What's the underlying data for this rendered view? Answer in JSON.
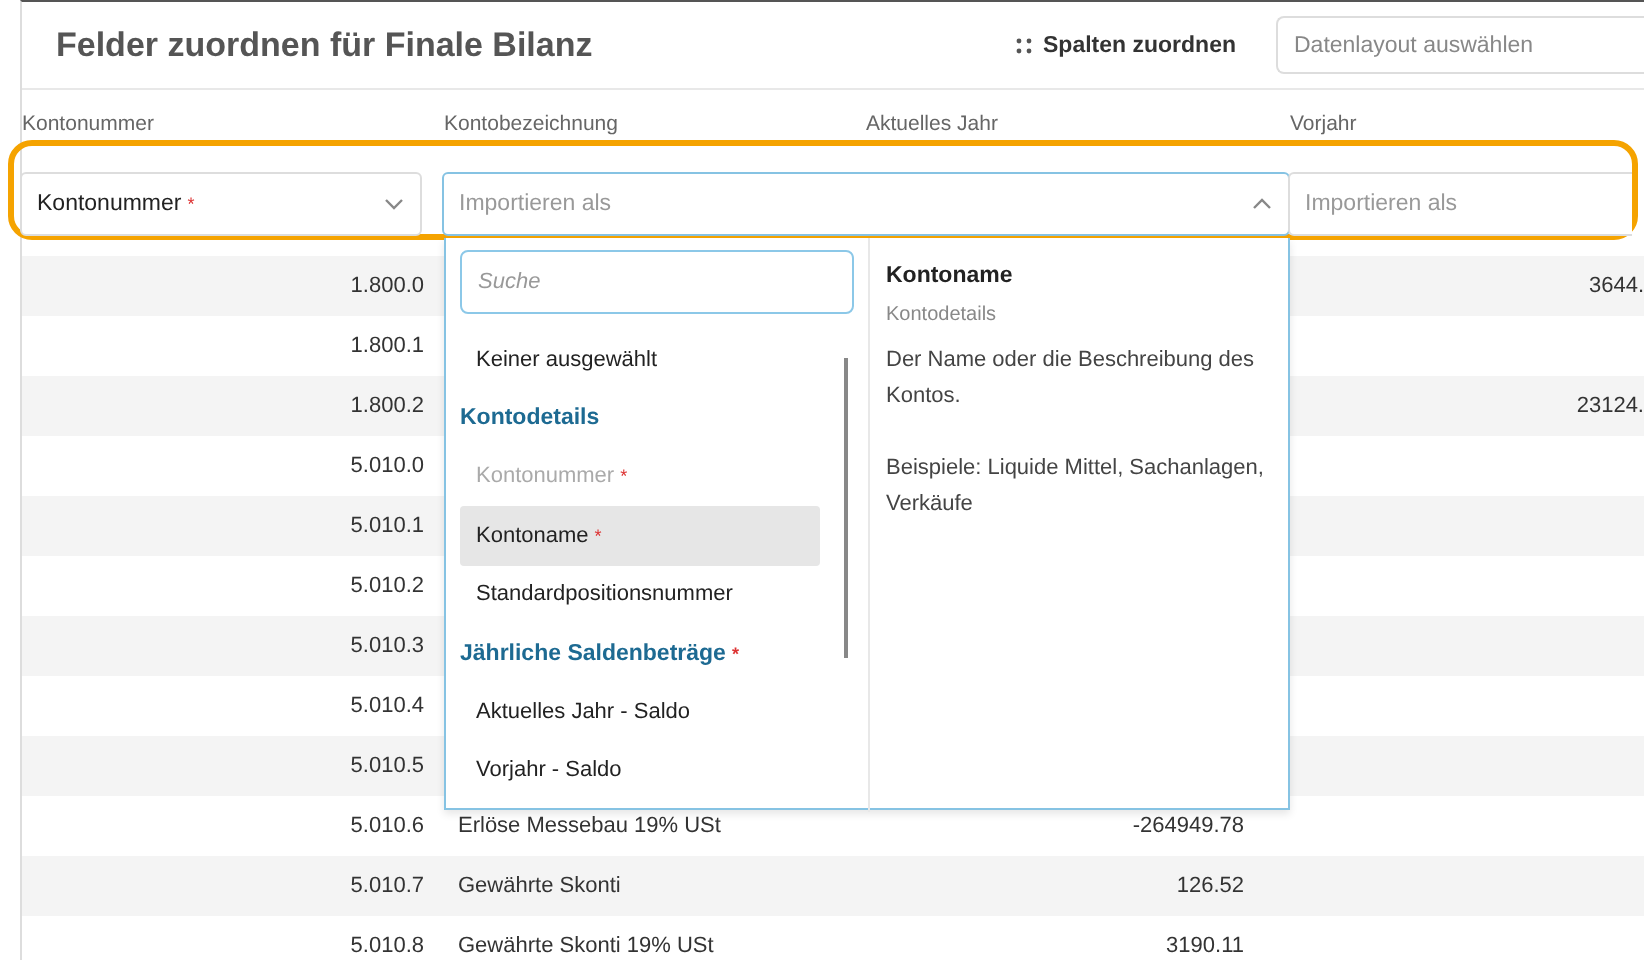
{
  "header": {
    "title": "Felder zuordnen für Finale Bilanz",
    "map_columns_button": "Spalten zuordnen",
    "layout_select": {
      "placeholder": "Datenlayout auswählen"
    }
  },
  "column_headers": [
    "Kontonummer",
    "Kontobezeichnung",
    "Aktuelles Jahr",
    "Vorjahr"
  ],
  "mappings": [
    {
      "kind": "value",
      "value": "Kontonummer",
      "required_mark": "*",
      "expanded": false
    },
    {
      "kind": "placeholder",
      "placeholder": "Importieren als",
      "expanded": true
    },
    {
      "kind": "placeholder",
      "placeholder": "Importieren als",
      "expanded": false
    }
  ],
  "rows": [
    {
      "number": "1.800.0",
      "previous": "3644."
    },
    {
      "number": "1.800.1"
    },
    {
      "number": "1.800.2",
      "previous": "23124."
    },
    {
      "number": "5.010.0"
    },
    {
      "number": "5.010.1"
    },
    {
      "number": "5.010.2"
    },
    {
      "number": "5.010.3"
    },
    {
      "number": "5.010.4"
    },
    {
      "number": "5.010.5"
    },
    {
      "number": "5.010.6",
      "name": "Erlöse Messebau 19% USt",
      "current": "-264949.78"
    },
    {
      "number": "5.010.7",
      "name": "Gewährte Skonti",
      "current": "126.52"
    },
    {
      "number": "5.010.8",
      "name": "Gewährte Skonti 19% USt",
      "current": "3190.11"
    }
  ],
  "dropdown": {
    "search": {
      "placeholder": "Suche"
    },
    "items": [
      {
        "kind": "option",
        "label": "Keiner ausgewählt",
        "disabled": false,
        "selected": false
      },
      {
        "kind": "group",
        "label": "Kontodetails"
      },
      {
        "kind": "option",
        "label": "Kontonummer",
        "required_mark": "*",
        "disabled": true,
        "selected": false
      },
      {
        "kind": "option",
        "label": "Kontoname",
        "required_mark": "*",
        "disabled": false,
        "selected": true
      },
      {
        "kind": "option",
        "label": "Standardpositionsnummer",
        "disabled": false,
        "selected": false
      },
      {
        "kind": "group",
        "label": "Jährliche Saldenbeträge",
        "required_mark": "*"
      },
      {
        "kind": "option",
        "label": "Aktuelles Jahr - Saldo",
        "disabled": false,
        "selected": false
      },
      {
        "kind": "option",
        "label": "Vorjahr - Saldo",
        "disabled": false,
        "selected": false
      }
    ],
    "details": {
      "title": "Kontoname",
      "category": "Kontodetails",
      "description": "Der Name oder die Beschreibung des Kontos.",
      "examples": "Beispiele: Liquide Mittel, Sachanlagen, Verkäufe"
    }
  },
  "highlight": {
    "on": true
  }
}
